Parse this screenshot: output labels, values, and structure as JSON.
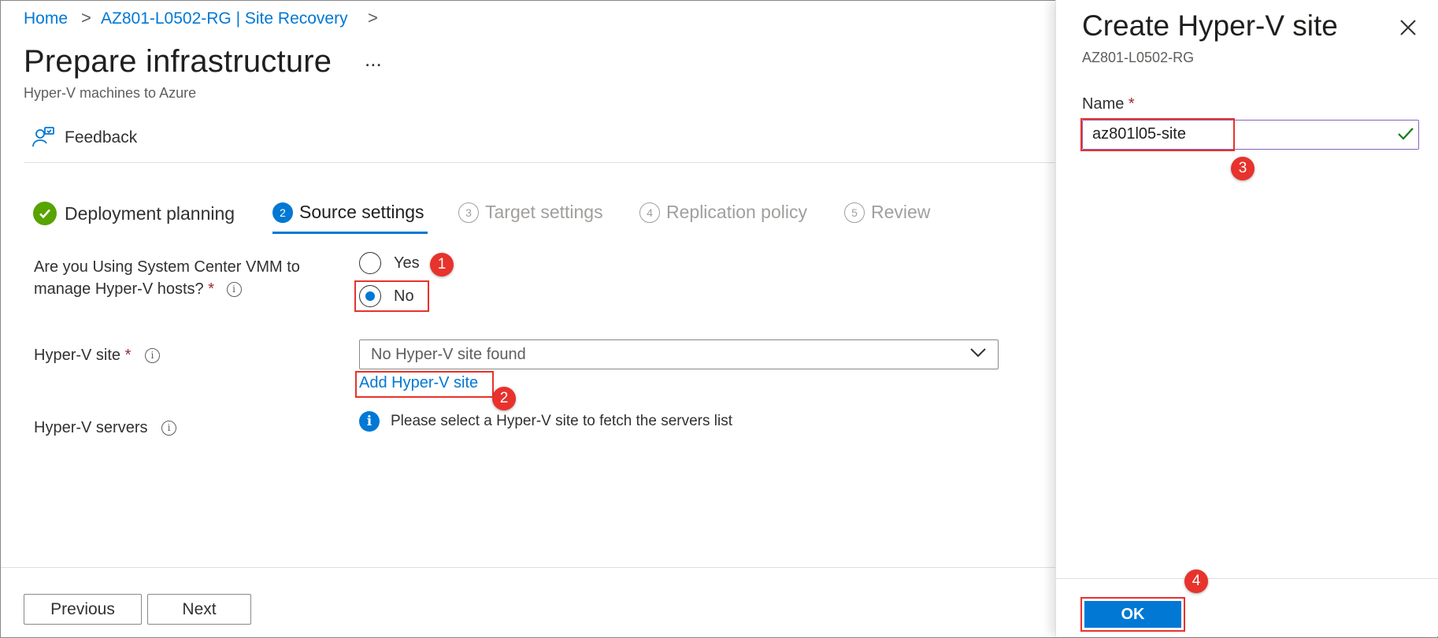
{
  "breadcrumb": {
    "home": "Home",
    "resource": "AZ801-L0502-RG | Site Recovery",
    "sep": ">"
  },
  "page": {
    "title": "Prepare infrastructure",
    "more": "...",
    "subtitle": "Hyper-V machines to Azure"
  },
  "toolbar": {
    "feedback": "Feedback"
  },
  "steps": [
    {
      "num": "✓",
      "label": "Deployment planning",
      "state": "complete"
    },
    {
      "num": "2",
      "label": "Source settings",
      "state": "active"
    },
    {
      "num": "3",
      "label": "Target settings",
      "state": "disabled"
    },
    {
      "num": "4",
      "label": "Replication policy",
      "state": "disabled"
    },
    {
      "num": "5",
      "label": "Review",
      "state": "disabled"
    }
  ],
  "form": {
    "vmm_question_line1": "Are you Using System Center VMM to",
    "vmm_question_line2": "manage Hyper-V hosts?",
    "required_mark": "*",
    "yes": "Yes",
    "no": "No",
    "selected": "No",
    "site_label": "Hyper-V site",
    "site_value": "No Hyper-V site found",
    "add_site": "Add Hyper-V site",
    "servers_label": "Hyper-V servers",
    "servers_info": "Please select a Hyper-V site to fetch the servers list",
    "info_glyph": "i"
  },
  "footer": {
    "previous": "Previous",
    "next": "Next"
  },
  "panel": {
    "title": "Create Hyper-V site",
    "subtitle": "AZ801-L0502-RG",
    "name_label": "Name",
    "name_value": "az801l05-site",
    "ok": "OK",
    "close": "✕"
  },
  "callouts": [
    "1",
    "2",
    "3",
    "4"
  ],
  "colors": {
    "accent": "#0078d4",
    "callout": "#e8322c",
    "success": "#107c10",
    "required": "#a4262c"
  }
}
